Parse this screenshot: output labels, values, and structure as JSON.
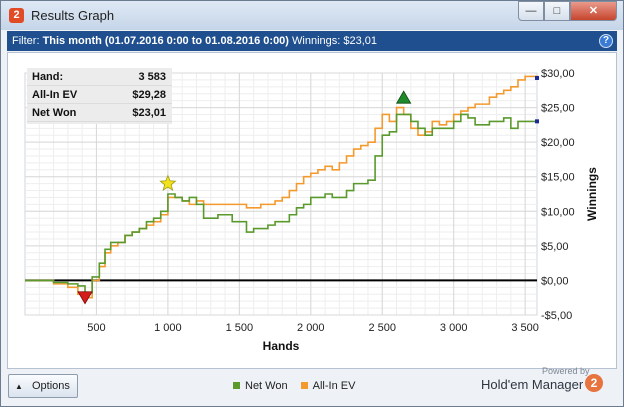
{
  "window": {
    "title": "Results Graph",
    "app_icon_text": "2",
    "minimize_glyph": "—",
    "maximize_glyph": "□",
    "close_glyph": "✕"
  },
  "filter": {
    "label": "Filter:",
    "period": "This month (01.07.2016 0:00 to 01.08.2016 0:00)",
    "winnings": "Winnings: $23,01",
    "help_glyph": "?"
  },
  "stats": [
    {
      "label": "Hand:",
      "value": "3 583"
    },
    {
      "label": "All-In EV",
      "value": "$29,28"
    },
    {
      "label": "Net Won",
      "value": "$23,01"
    }
  ],
  "footer": {
    "options_label": "Options",
    "powered_by": "Powered by",
    "brand": "Hold'em Manager",
    "brand_icon_text": "2"
  },
  "legend": [
    {
      "name": "Net Won",
      "color": "#5a9a2c"
    },
    {
      "name": "All-In EV",
      "color": "#f39a2e"
    }
  ],
  "chart_data": {
    "type": "line",
    "xlabel": "Hands",
    "ylabel": "Winnings",
    "xlim": [
      0,
      3583
    ],
    "ylim": [
      -5,
      30
    ],
    "xticks": [
      500,
      1000,
      1500,
      2000,
      2500,
      3000,
      3500
    ],
    "xtick_labels": [
      "500",
      "1 000",
      "1 500",
      "2 000",
      "2 500",
      "3 000",
      "3 500"
    ],
    "yticks": [
      -5,
      0,
      5,
      10,
      15,
      20,
      25,
      30
    ],
    "ytick_labels": [
      "-$5,00",
      "$0,00",
      "$5,00",
      "$10,00",
      "$15,00",
      "$20,00",
      "$25,00",
      "$30,00"
    ],
    "grid": true,
    "zero_line": 0,
    "series": [
      {
        "name": "Net Won",
        "color": "#5a9a2c",
        "x": [
          0,
          100,
          200,
          300,
          370,
          420,
          470,
          520,
          560,
          600,
          650,
          700,
          750,
          800,
          850,
          900,
          950,
          1000,
          1050,
          1100,
          1150,
          1200,
          1250,
          1300,
          1350,
          1400,
          1450,
          1500,
          1550,
          1600,
          1650,
          1700,
          1750,
          1800,
          1850,
          1900,
          1950,
          2000,
          2050,
          2100,
          2150,
          2200,
          2250,
          2300,
          2350,
          2400,
          2450,
          2500,
          2550,
          2600,
          2650,
          2700,
          2750,
          2800,
          2850,
          2900,
          2950,
          3000,
          3050,
          3100,
          3150,
          3200,
          3250,
          3300,
          3350,
          3400,
          3450,
          3500,
          3583
        ],
        "y": [
          0,
          0,
          -0.3,
          -0.5,
          -0.8,
          -1.8,
          0.5,
          2.5,
          4.5,
          5.5,
          5.5,
          6.5,
          7,
          7.5,
          8.5,
          9,
          10,
          12.5,
          12,
          11.5,
          12,
          11,
          9,
          9,
          9.5,
          9.5,
          8.5,
          8.5,
          7,
          7.5,
          7.5,
          8,
          8.5,
          8.5,
          9.5,
          10.5,
          11,
          12,
          12,
          12.5,
          12,
          12,
          13,
          14,
          14,
          14.5,
          18,
          21,
          21.5,
          24,
          24,
          23,
          22,
          21,
          22,
          22,
          22,
          23,
          24,
          23.5,
          22.5,
          22.5,
          23,
          23,
          23.5,
          22,
          23,
          23,
          23.01
        ]
      },
      {
        "name": "All-In EV",
        "color": "#f39a2e",
        "x": [
          0,
          100,
          200,
          300,
          370,
          420,
          470,
          520,
          560,
          600,
          650,
          700,
          750,
          800,
          850,
          900,
          950,
          1000,
          1050,
          1100,
          1150,
          1200,
          1250,
          1300,
          1350,
          1400,
          1450,
          1500,
          1550,
          1600,
          1650,
          1700,
          1750,
          1800,
          1850,
          1900,
          1950,
          2000,
          2050,
          2100,
          2150,
          2200,
          2250,
          2300,
          2350,
          2400,
          2450,
          2500,
          2550,
          2600,
          2650,
          2700,
          2750,
          2800,
          2850,
          2900,
          2950,
          3000,
          3050,
          3100,
          3150,
          3200,
          3250,
          3300,
          3350,
          3400,
          3450,
          3500,
          3583
        ],
        "y": [
          0,
          0,
          -0.5,
          -1,
          -2,
          -2.5,
          0,
          2,
          4,
          5,
          5.5,
          6.5,
          7,
          7.5,
          8,
          8.5,
          9.5,
          12,
          12,
          11.5,
          11,
          11.5,
          11,
          11,
          11,
          11,
          11,
          11,
          10.5,
          10.5,
          11,
          11,
          11.5,
          12,
          13,
          14,
          15,
          15.5,
          16,
          16.5,
          16,
          17,
          18,
          19,
          19.5,
          20,
          22,
          24,
          23,
          25,
          24,
          22,
          21,
          21.5,
          23,
          22.5,
          23,
          24,
          24.5,
          25,
          25.5,
          25.5,
          26.5,
          27,
          27.5,
          28,
          29,
          29.5,
          29.28
        ]
      }
    ],
    "markers": [
      {
        "type": "min",
        "x": 420,
        "y": -2.5,
        "color": "#d51c1c"
      },
      {
        "type": "star",
        "x": 1000,
        "y": 14,
        "color": "#f2e21c"
      },
      {
        "type": "max",
        "x": 2650,
        "y": 26.5,
        "color": "#1f8a2b"
      }
    ]
  }
}
